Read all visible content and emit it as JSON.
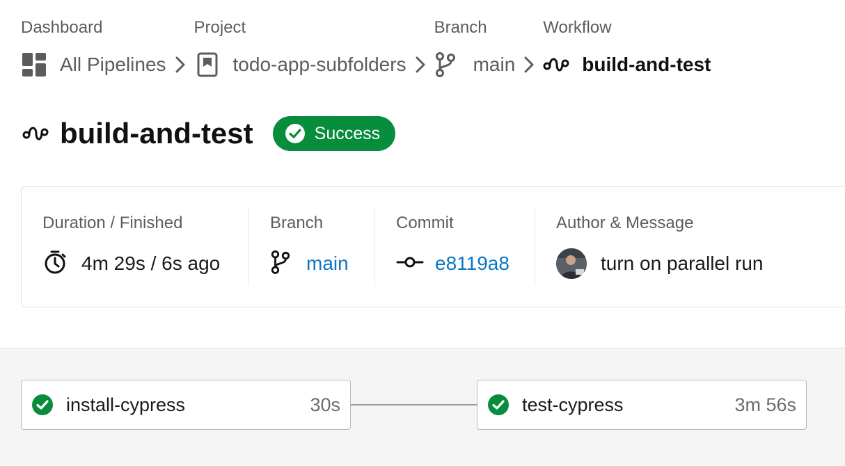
{
  "breadcrumb": {
    "items": [
      {
        "label": "Dashboard",
        "text": "All Pipelines"
      },
      {
        "label": "Project",
        "text": "todo-app-subfolders"
      },
      {
        "label": "Branch",
        "text": "main"
      },
      {
        "label": "Workflow",
        "text": "build-and-test"
      }
    ]
  },
  "header": {
    "title": "build-and-test",
    "status": "Success"
  },
  "summary": {
    "duration": {
      "label": "Duration / Finished",
      "value": "4m 29s / 6s ago"
    },
    "branch": {
      "label": "Branch",
      "value": "main"
    },
    "commit": {
      "label": "Commit",
      "value": "e8119a8"
    },
    "author": {
      "label": "Author & Message",
      "message": "turn on parallel run"
    }
  },
  "jobs": [
    {
      "name": "install-cypress",
      "duration": "30s",
      "status": "success"
    },
    {
      "name": "test-cypress",
      "duration": "3m 56s",
      "status": "success"
    }
  ],
  "colors": {
    "success": "#078d3c",
    "link": "#0b76c4",
    "muted": "#5c5c5c"
  }
}
